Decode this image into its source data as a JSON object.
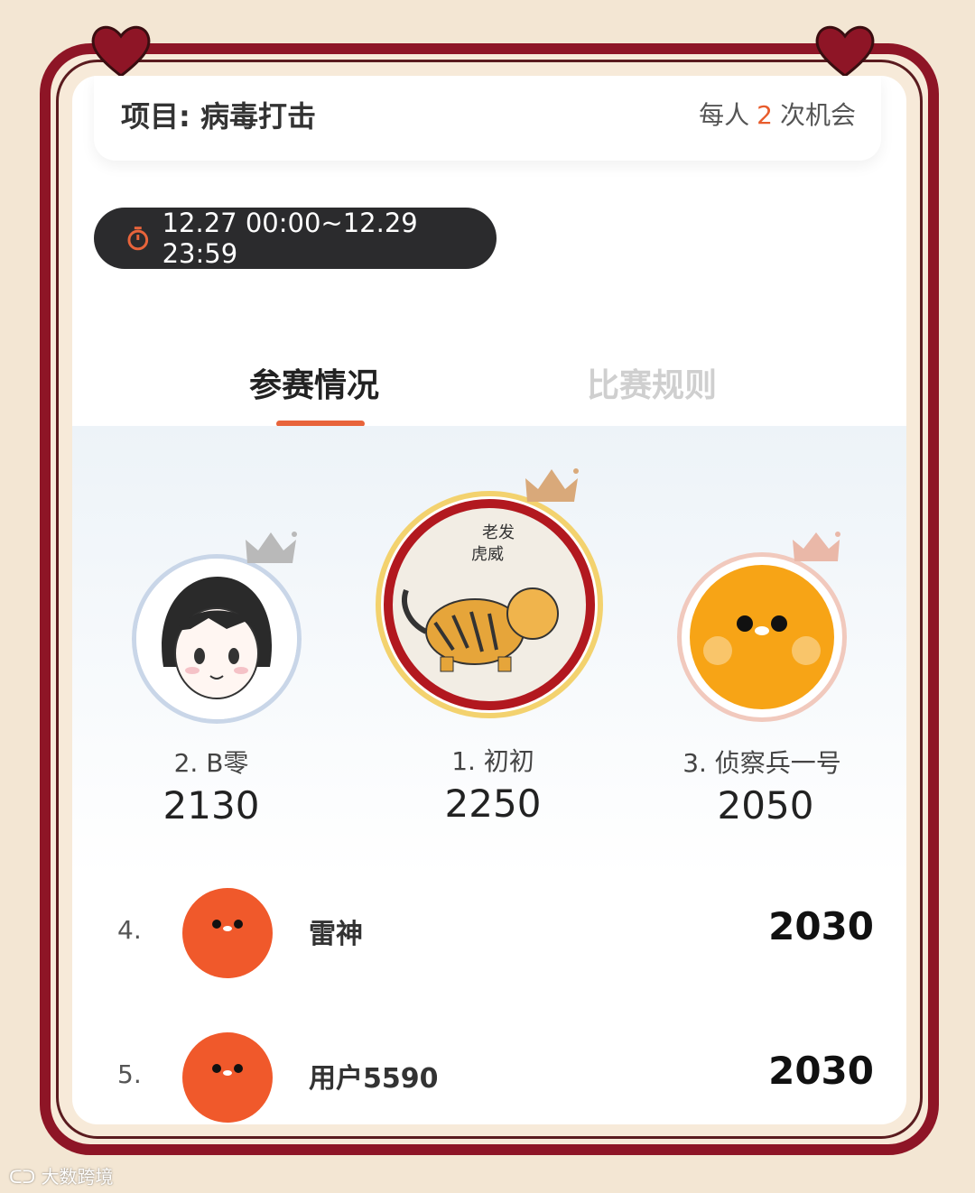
{
  "header": {
    "project_label": "项目: 病毒打击",
    "chances_prefix": "每人",
    "chances_count": "2",
    "chances_suffix": "次机会"
  },
  "time_range": "12.27 00:00~12.29 23:59",
  "tabs": [
    {
      "label": "参赛情况",
      "active": true
    },
    {
      "label": "比赛规则",
      "active": false
    }
  ],
  "podium": [
    {
      "rank_label": "2. B零",
      "score": "2130",
      "crown": "silver"
    },
    {
      "rank_label": "1. 初初",
      "score": "2250",
      "crown": "gold",
      "avatar_text": [
        "老发",
        "虎威"
      ]
    },
    {
      "rank_label": "3. 侦察兵一号",
      "score": "2050",
      "crown": "bronze"
    }
  ],
  "list": [
    {
      "rank": "4.",
      "name": "雷神",
      "score": "2030"
    },
    {
      "rank": "5.",
      "name": "用户5590",
      "score": "2030"
    }
  ],
  "watermark": "大数跨境",
  "colors": {
    "frame": "#8e1526",
    "accent": "#e8643b",
    "pill": "#2b2b2d",
    "avatar_orange": "#f0592b",
    "avatar_yellow": "#f7a416"
  }
}
